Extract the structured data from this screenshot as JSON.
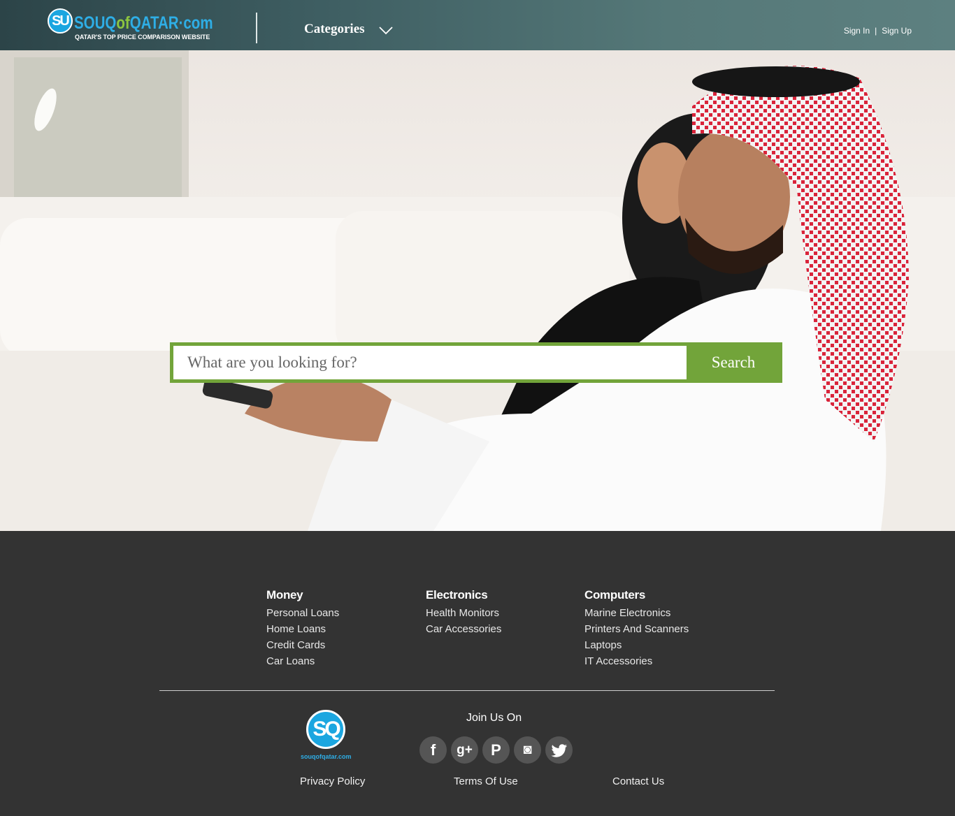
{
  "header": {
    "logo_badge": "SU",
    "logo_word_prefix": "SOUQ",
    "logo_word_of": "of",
    "logo_word_suffix": "QATAR·com",
    "logo_tagline": "QATAR'S TOP PRICE COMPARISON WEBSITE",
    "categories_label": "Categories",
    "sign_in": "Sign In",
    "separator": "|",
    "sign_up": "Sign Up"
  },
  "search": {
    "placeholder": "What are you looking for?",
    "button_label": "Search"
  },
  "footer": {
    "columns": [
      {
        "title": "Money",
        "links": [
          "Personal Loans",
          "Home Loans",
          "Credit Cards",
          "Car Loans"
        ]
      },
      {
        "title": "Electronics",
        "links": [
          "Health Monitors",
          "Car Accessories"
        ]
      },
      {
        "title": "Computers",
        "links": [
          "Marine Electronics",
          "Printers And Scanners",
          "Laptops",
          "IT Accessories"
        ]
      }
    ],
    "logo_badge": "SQ",
    "logo_text": "souqofqatar.com",
    "join_label": "Join Us On",
    "socials": [
      {
        "name": "facebook-icon",
        "glyph": "f"
      },
      {
        "name": "google-plus-icon",
        "glyph": "g+"
      },
      {
        "name": "pinterest-icon",
        "glyph": "P"
      },
      {
        "name": "instagram-icon",
        "glyph": "◙"
      },
      {
        "name": "twitter-icon",
        "glyph": "🐦"
      }
    ],
    "privacy": "Privacy Policy",
    "terms": "Terms Of Use",
    "contact": "Contact Us"
  },
  "colors": {
    "accent_green": "#72a43a",
    "brand_blue": "#1ba6e0",
    "footer_bg": "#333333"
  }
}
